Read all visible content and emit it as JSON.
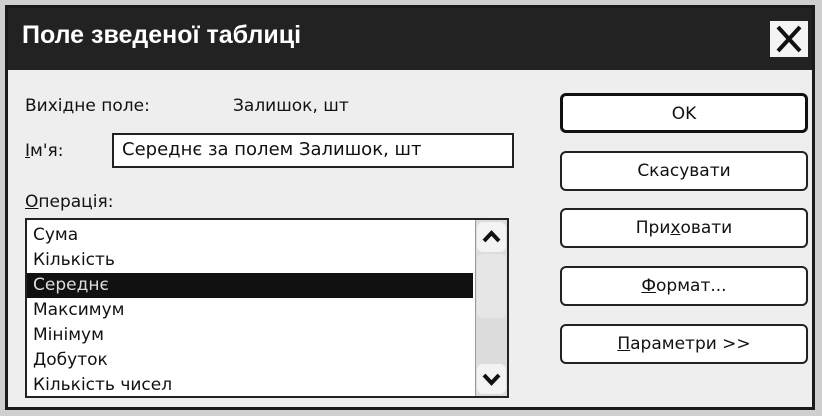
{
  "dialog": {
    "title": "Поле зведеної таблиці",
    "source_field_label": "Вихідне поле:",
    "source_field_value": "Залишок, шт",
    "name_label_prefix": "І",
    "name_label_rest": "м'я:",
    "name_value": "Середнє за полем Залишок, шт",
    "operation_label_underlined": "О",
    "operation_label_rest": "перація:",
    "operations": [
      "Сума",
      "Кількість",
      "Середнє",
      "Максимум",
      "Мінімум",
      "Добуток",
      "Кількість чисел"
    ],
    "selected_operation": "Середнє"
  },
  "buttons": {
    "ok": "OK",
    "cancel": "Скасувати",
    "hide_pre": "При",
    "hide_u": "х",
    "hide_post": "овати",
    "format_u": "Ф",
    "format_rest": "ормат...",
    "options_u": "П",
    "options_rest": "араметри >>"
  },
  "icons": {
    "close": "close-icon",
    "scroll_up": "chevron-up-icon",
    "scroll_down": "chevron-down-icon"
  },
  "colors": {
    "title_bar": "#222222",
    "selection": "#111111",
    "dialog_bg": "#eeeeee"
  }
}
